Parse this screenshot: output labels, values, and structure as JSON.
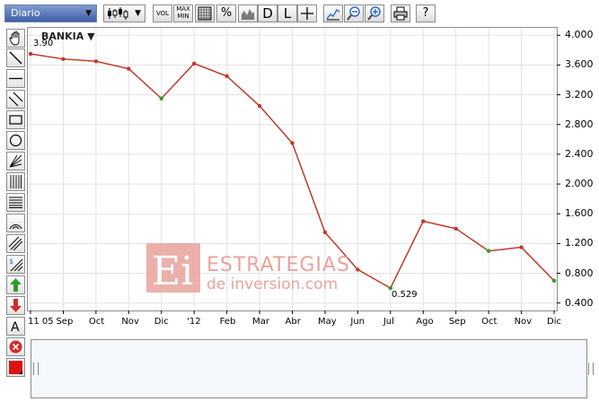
{
  "toolbar": {
    "period": "Diario",
    "vol_label": "VOL",
    "maxmin_label": "MAX\nMIN",
    "percent_label": "%",
    "d_label": "D",
    "l_label": "L",
    "help_label": "?"
  },
  "chart": {
    "symbol": "BANKIA",
    "symbol_arrow": "▼",
    "high_label": "3.90",
    "low_label": "0.529",
    "y_ticks": [
      "4.000",
      "3.600",
      "3.200",
      "2.800",
      "2.400",
      "2.000",
      "1.600",
      "1.200",
      "0.800",
      "0.400"
    ],
    "x_ticks": [
      "11 05",
      "Sep",
      "Oct",
      "Nov",
      "Dic",
      "'12",
      "Feb",
      "Mar",
      "Abr",
      "May",
      "Jun",
      "Jul",
      "Ago",
      "Sep",
      "Oct",
      "Nov",
      "Dic"
    ],
    "watermark_line1": "ESTRATEGIAS",
    "watermark_line2": "de inversion.com"
  },
  "colors": {
    "up": "#2e9a2e",
    "down": "#c0392b",
    "nav_line": "#2a3f66",
    "border": "#8c8c8c"
  },
  "chart_data": {
    "type": "line",
    "title": "BANKIA",
    "ylim": [
      0.3,
      4.1
    ],
    "x": [
      "11 05",
      "Sep",
      "Oct",
      "Nov",
      "Dic",
      "'12",
      "Feb",
      "Mar",
      "Abr",
      "May",
      "Jun",
      "Jul",
      "Ago",
      "Sep",
      "Oct",
      "Nov",
      "Dic"
    ],
    "series": [
      {
        "values": [
          3.75,
          3.68,
          3.65,
          3.55,
          3.15,
          3.62,
          3.45,
          3.05,
          2.55,
          1.35,
          0.85,
          0.6,
          1.5,
          1.4,
          1.1,
          1.15,
          0.7
        ]
      }
    ],
    "annotations": [
      {
        "label": "3.90",
        "x": "11 05",
        "y": 3.9
      },
      {
        "label": "0.529",
        "x": "Jul",
        "y": 0.529
      }
    ]
  }
}
